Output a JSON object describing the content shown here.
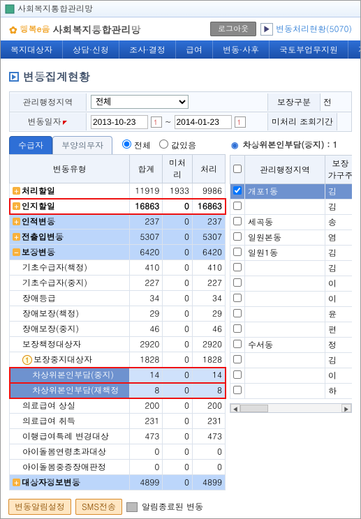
{
  "window": {
    "title": "사회복지통합관리망"
  },
  "header": {
    "logo_prefix": "행복e음",
    "logo_text": "사회복지통합관리망",
    "logout": "로그아웃",
    "status": "변동처리현황(5070)"
  },
  "nav": [
    "복지대상자",
    "상담·신청",
    "조사·결정",
    "급여",
    "변동·사후",
    "국토부업무지원",
    "자료"
  ],
  "page_title": "변동집계현황",
  "filters": {
    "region_label": "관리행정지역",
    "region_value": "전체",
    "date_label": "변동일자",
    "date_from": "2013-10-23",
    "date_to": "2014-01-23",
    "class_label": "보장구분",
    "class_value": "전",
    "period_label": "미처리 조회기간"
  },
  "tabs": {
    "recipient": "수급자",
    "supporter": "부양의무자"
  },
  "radio": {
    "all": "전체",
    "nonzero": "값있음"
  },
  "right_title": "차상위본인부담(중지) : 1",
  "left_table": {
    "headers": [
      "변동유형",
      "합계",
      "미처리",
      "처리"
    ],
    "rows": [
      {
        "kind": "top",
        "exp": "+",
        "label": "처리할일",
        "a": "11919",
        "b": "1933",
        "c": "9986"
      },
      {
        "kind": "red",
        "exp": "+",
        "label": "인지할일",
        "a": "16863",
        "b": "0",
        "c": "16863"
      },
      {
        "kind": "sel",
        "exp": "+",
        "label": "인적변동",
        "a": "237",
        "b": "0",
        "c": "237"
      },
      {
        "kind": "sel",
        "exp": "+",
        "label": "전출입변동",
        "a": "5307",
        "b": "0",
        "c": "5307"
      },
      {
        "kind": "sel",
        "exp": "-",
        "label": "보장변동",
        "a": "6420",
        "b": "0",
        "c": "6420"
      },
      {
        "kind": "plain",
        "ind": 1,
        "label": "기초수급자(책정)",
        "a": "410",
        "b": "0",
        "c": "410"
      },
      {
        "kind": "plain",
        "ind": 1,
        "label": "기초수급자(중지)",
        "a": "227",
        "b": "0",
        "c": "227"
      },
      {
        "kind": "plain",
        "ind": 1,
        "label": "장애등급",
        "a": "34",
        "b": "0",
        "c": "34"
      },
      {
        "kind": "plain",
        "ind": 1,
        "label": "장애보장(책정)",
        "a": "29",
        "b": "0",
        "c": "29"
      },
      {
        "kind": "plain",
        "ind": 1,
        "label": "장애보장(중지)",
        "a": "46",
        "b": "0",
        "c": "46"
      },
      {
        "kind": "plain",
        "ind": 1,
        "label": "보장책정대상자",
        "a": "2920",
        "b": "0",
        "c": "2920"
      },
      {
        "kind": "mark1",
        "ind": 1,
        "label": "보장중지대상자",
        "a": "1828",
        "b": "0",
        "c": "1828"
      },
      {
        "kind": "band",
        "ind": 2,
        "label": "차상위본인부담(중지)",
        "a": "14",
        "b": "0",
        "c": "14",
        "red": true
      },
      {
        "kind": "band",
        "ind": 2,
        "label": "차상위본인부담(재책정",
        "a": "8",
        "b": "0",
        "c": "8",
        "red": true
      },
      {
        "kind": "plain",
        "ind": 1,
        "label": "의료급여 상실",
        "a": "200",
        "b": "0",
        "c": "200"
      },
      {
        "kind": "plain",
        "ind": 1,
        "label": "의료급여 취득",
        "a": "231",
        "b": "0",
        "c": "231"
      },
      {
        "kind": "plain",
        "ind": 1,
        "label": "이행급여특례 변경대상",
        "a": "473",
        "b": "0",
        "c": "473"
      },
      {
        "kind": "plain",
        "ind": 1,
        "label": "아이돌봄연령초과대상",
        "a": "0",
        "b": "0",
        "c": "0"
      },
      {
        "kind": "plain",
        "ind": 1,
        "label": "아이돌봄중증장애판정",
        "a": "0",
        "b": "0",
        "c": "0"
      },
      {
        "kind": "sel",
        "exp": "+",
        "label": "대상자정보변동",
        "a": "4899",
        "b": "0",
        "c": "4899"
      }
    ]
  },
  "right_table": {
    "headers": [
      "",
      "관리행정지역",
      "보장\n가구주"
    ],
    "rows": [
      {
        "sel": true,
        "region": "개포1동",
        "name": "김"
      },
      {
        "region": "",
        "name": "김"
      },
      {
        "region": "세곡동",
        "name": "송"
      },
      {
        "region": "일원본동",
        "name": "염"
      },
      {
        "region": "일원1동",
        "name": "김"
      },
      {
        "region": "",
        "name": "김"
      },
      {
        "region": "",
        "name": "이"
      },
      {
        "region": "",
        "name": "이"
      },
      {
        "region": "",
        "name": "윤"
      },
      {
        "region": "",
        "name": "편"
      },
      {
        "region": "수서동",
        "name": "정"
      },
      {
        "region": "",
        "name": "김"
      },
      {
        "region": "",
        "name": "이"
      },
      {
        "region": "",
        "name": "하"
      }
    ]
  },
  "bottom": {
    "btn1": "변동알림설정",
    "btn2": "SMS전송",
    "legend": "알림종료된 변동"
  }
}
